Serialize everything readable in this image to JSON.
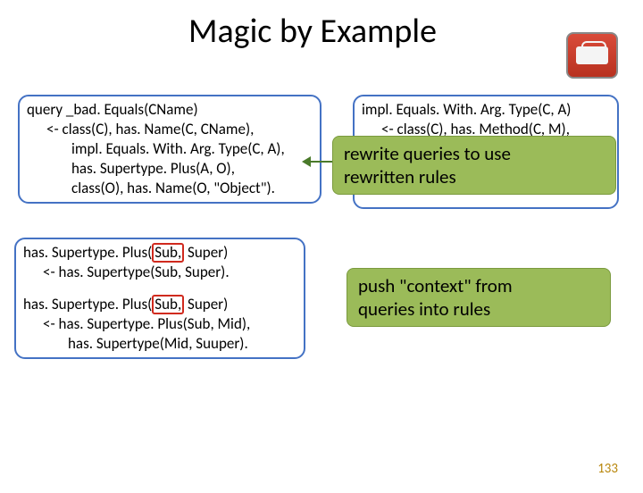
{
  "title": "Magic by Example",
  "icon": "keyboard-icon",
  "box1": {
    "l1": "query _bad. Equals(CName)",
    "l2": "<- class(C), has. Name(C, CName),",
    "l3": "impl. Equals. With. Arg. Type(C, A),",
    "l4": "has. Supertype. Plus(A, O),",
    "l5": "class(O), has. Name(O, \"Object\")."
  },
  "box2": {
    "l1": "impl. Equals. With. Arg. Type(C, A)",
    "l2": "<- class(C), has. Method(C, M),"
  },
  "box3": {
    "l1a": "has. Supertype. Plus(",
    "l1b": "Sub,",
    "l1c": " Super)",
    "l2": "<- has. Supertype(Sub, Super).",
    "l3a": "has. Supertype. Plus(",
    "l3b": "Sub,",
    "l3c": " Super)",
    "l4": "<- has. Supertype. Plus(Sub, Mid),",
    "l5": "has. Supertype(Mid, Suuper)."
  },
  "callout1": {
    "l1": "rewrite queries to use",
    "l2": "rewritten rules"
  },
  "callout2": {
    "l1": "push \"context\" from",
    "l2": "queries into rules"
  },
  "pagenum": "133"
}
